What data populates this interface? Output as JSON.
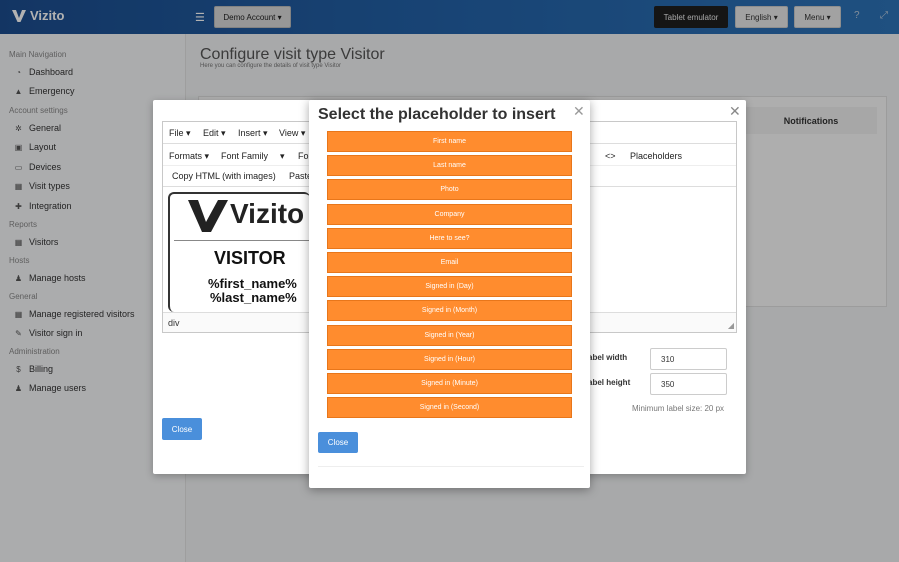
{
  "app": {
    "logo_text": "Vizito",
    "account_button": "Demo Account ▾",
    "tablet_button": "Tablet emulator",
    "language_button": "English ▾",
    "menu_button": "Menu ▾"
  },
  "sidebar": {
    "sections": [
      {
        "title": "Main Navigation",
        "items": [
          {
            "label": "Dashboard",
            "icon": "dashboard-icon"
          },
          {
            "label": "Emergency",
            "icon": "warning-icon"
          }
        ]
      },
      {
        "title": "Account settings",
        "items": [
          {
            "label": "General",
            "icon": "gear-icon"
          },
          {
            "label": "Layout",
            "icon": "image-icon"
          },
          {
            "label": "Devices",
            "icon": "tablet-icon"
          },
          {
            "label": "Visit types",
            "icon": "users-icon"
          },
          {
            "label": "Integration",
            "icon": "link-icon"
          }
        ]
      },
      {
        "title": "Reports",
        "items": [
          {
            "label": "Visitors",
            "icon": "users-icon"
          }
        ]
      },
      {
        "title": "Hosts",
        "items": [
          {
            "label": "Manage hosts",
            "icon": "person-icon"
          }
        ]
      },
      {
        "title": "General",
        "items": [
          {
            "label": "Manage registered visitors",
            "icon": "users-icon"
          },
          {
            "label": "Visitor sign in",
            "icon": "pen-icon"
          }
        ]
      },
      {
        "title": "Administration",
        "items": [
          {
            "label": "Billing",
            "icon": "dollar-icon"
          },
          {
            "label": "Manage users",
            "icon": "add-user-icon"
          }
        ]
      }
    ]
  },
  "page": {
    "title": "Configure visit type Visitor",
    "subtitle": "Here you can configure the details of visit type Visitor",
    "notifications_header": "Notifications"
  },
  "editor": {
    "menus": [
      "File ▾",
      "Edit ▾",
      "Insert ▾",
      "View ▾"
    ],
    "formats": "Formats ▾",
    "font_family": "Font Family",
    "font_size_partial": "Fo",
    "code_icon_text": "<>",
    "placeholders_button": "Placeholders",
    "copy_html_button": "Copy HTML (with images)",
    "paste_button": "Paste",
    "preview": {
      "logo": "Vizito",
      "heading": "VISITOR",
      "line1": "%first_name%",
      "line2": "%last_name%"
    },
    "status_path": "div"
  },
  "label_settings": {
    "width_label": "abel width",
    "width_value": "310",
    "height_label": "abel height",
    "height_value": "350",
    "min_size_text": "Minimum label size: 20 px"
  },
  "back_modal": {
    "close_label": "Close"
  },
  "placeholder_modal": {
    "title": "Select the placeholder to insert",
    "close_label": "Close",
    "options": [
      "First name",
      "Last name",
      "Photo",
      "Company",
      "Here to see?",
      "Email",
      "Signed in (Day)",
      "Signed in (Month)",
      "Signed in (Year)",
      "Signed in (Hour)",
      "Signed in (Minute)",
      "Signed in (Second)"
    ]
  },
  "colors": {
    "topbar": "#2362a8",
    "accent_orange": "#ff8c2e",
    "primary_blue": "#4a8fdb"
  }
}
